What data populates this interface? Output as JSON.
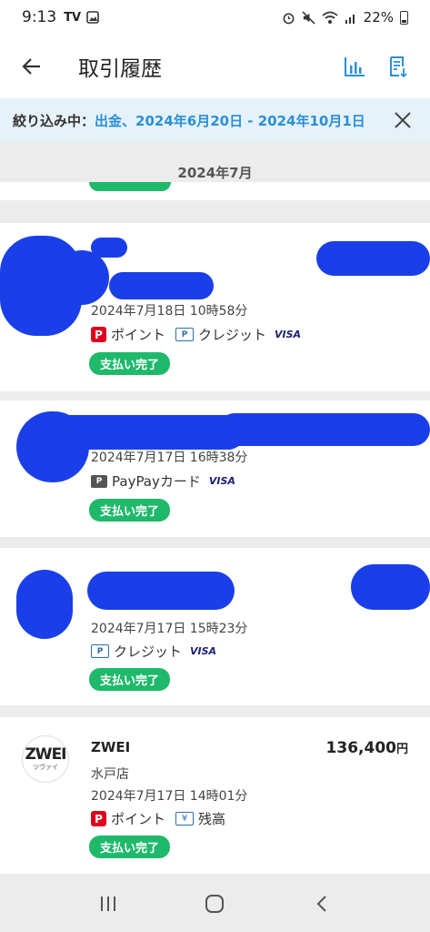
{
  "status_bar": {
    "time": "9:13",
    "notif": "TV",
    "battery": "22%"
  },
  "app_bar": {
    "title": "取引履歴"
  },
  "filter": {
    "label": "絞り込み中：",
    "value": "出金、2024年6月20日 - 2024年10月1日"
  },
  "month": "2024年7月",
  "transactions": [
    {
      "date": "2024年7月18日 10時58分",
      "method1": "ポイント",
      "method2": "クレジット",
      "visa": "VISA",
      "status": "支払い完了"
    },
    {
      "date": "2024年7月17日 16時38分",
      "method1": "PayPayカード",
      "visa": "VISA",
      "status": "支払い完了"
    },
    {
      "date": "2024年7月17日 15時23分",
      "method1": "クレジット",
      "visa": "VISA",
      "status": "支払い完了"
    },
    {
      "merchant": "ZWEI",
      "store": "水戸店",
      "amount": "136,400",
      "currency": "円",
      "date": "2024年7月17日 14時01分",
      "method1": "ポイント",
      "method2": "残高",
      "status": "支払い完了",
      "logo_text": "ZWEI",
      "logo_sub": "ツヴァイ"
    }
  ],
  "colors": {
    "accent": "#2a8fd6",
    "status_green": "#1fb96b",
    "paypay_red": "#e0001c",
    "scribble": "#1a3fe8"
  }
}
